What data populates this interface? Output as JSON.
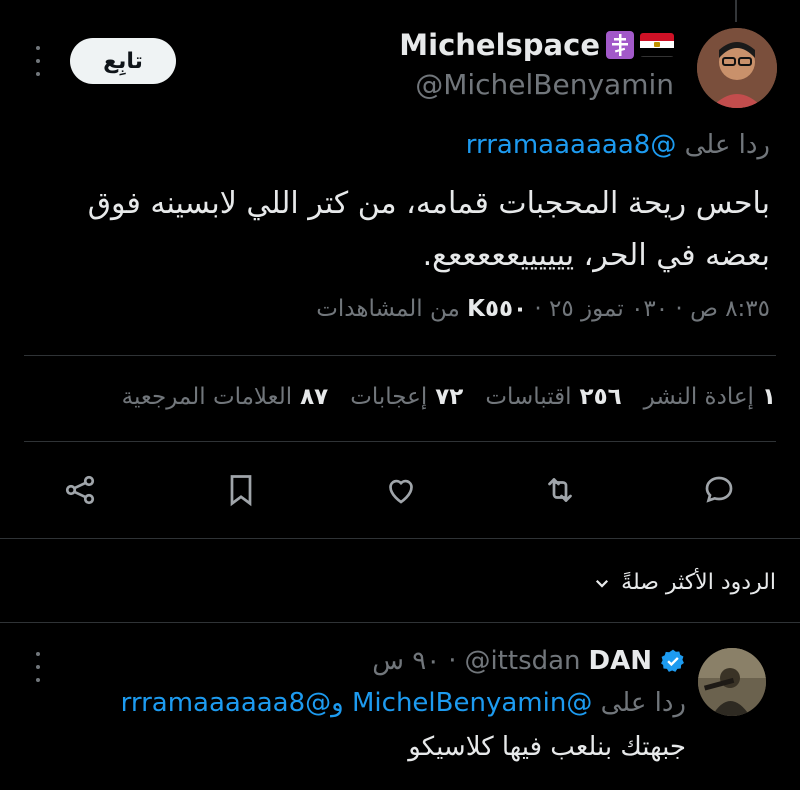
{
  "tweet": {
    "display_name": "Michelspace",
    "handle": "@MichelBenyamin",
    "follow_label": "تابِع",
    "reply_to_prefix": "ردا على",
    "reply_to_mention": "@rrramaaaaaa8",
    "text": "باحس ريحة المحجبات قمامه، من كتر اللي لابسينه فوق بعضه في الحر، ييييييعععععع.",
    "time": "٨:٣٥ ص",
    "date": "٠٣٠ تموز ٢٥",
    "views_count": "K٥٥٠",
    "views_label": "من المشاهدات",
    "stats": [
      {
        "count": "١",
        "label": "إعادة النشر"
      },
      {
        "count": "٢٥٦",
        "label": "اقتباسات"
      },
      {
        "count": "٧٢",
        "label": "إعجابات"
      },
      {
        "count": "٨٧",
        "label": "العلامات المرجعية"
      }
    ]
  },
  "replies_section": {
    "sort_label": "الردود الأكثر صلةً"
  },
  "reply": {
    "display_name": "DAN",
    "handle": "@ittsdan",
    "time": "٩٠ س",
    "reply_to_prefix": "ردا على",
    "reply_to_mentions": "@MichelBenyamin و@rrramaaaaaa8",
    "text": "جبهتك بنلعب فيها كلاسيكو"
  },
  "colors": {
    "accent": "#1d9bf0",
    "muted": "#71767b",
    "background": "#000000"
  },
  "icons": [
    "cross-badge-icon",
    "egypt-flag-icon",
    "more-icon",
    "reply-icon",
    "repost-icon",
    "like-icon",
    "bookmark-icon",
    "share-icon",
    "chevron-down-icon",
    "verified-icon"
  ]
}
